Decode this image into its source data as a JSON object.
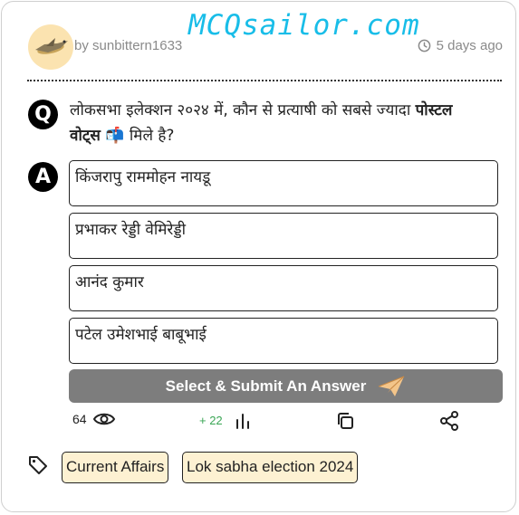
{
  "watermark": "MCQsailor.com",
  "author": {
    "name": "by sunbittern1633"
  },
  "time": {
    "label": "5 days ago"
  },
  "question": {
    "badge": "Q",
    "text_before": "लोकसभा इलेक्शन २०२४ में, कौन से प्रत्याषी को सबसे ज्यादा ",
    "text_bold": "पोस्टल वोट्स",
    "emoji": "📬",
    "text_after": " मिले है?"
  },
  "answers": {
    "badge": "A",
    "options": [
      "किंजरापु राममोहन नायडू",
      "प्रभाकर रेड्डी वेमिरेड्डी",
      "आनंद कुमार",
      "पटेल उमेशभाई बाबूभाई"
    ]
  },
  "submit": {
    "label": "Select & Submit An Answer"
  },
  "stats": {
    "views": "64",
    "votes": "+ 22"
  },
  "tags": [
    "Current Affairs",
    "Lok sabha election 2024"
  ]
}
